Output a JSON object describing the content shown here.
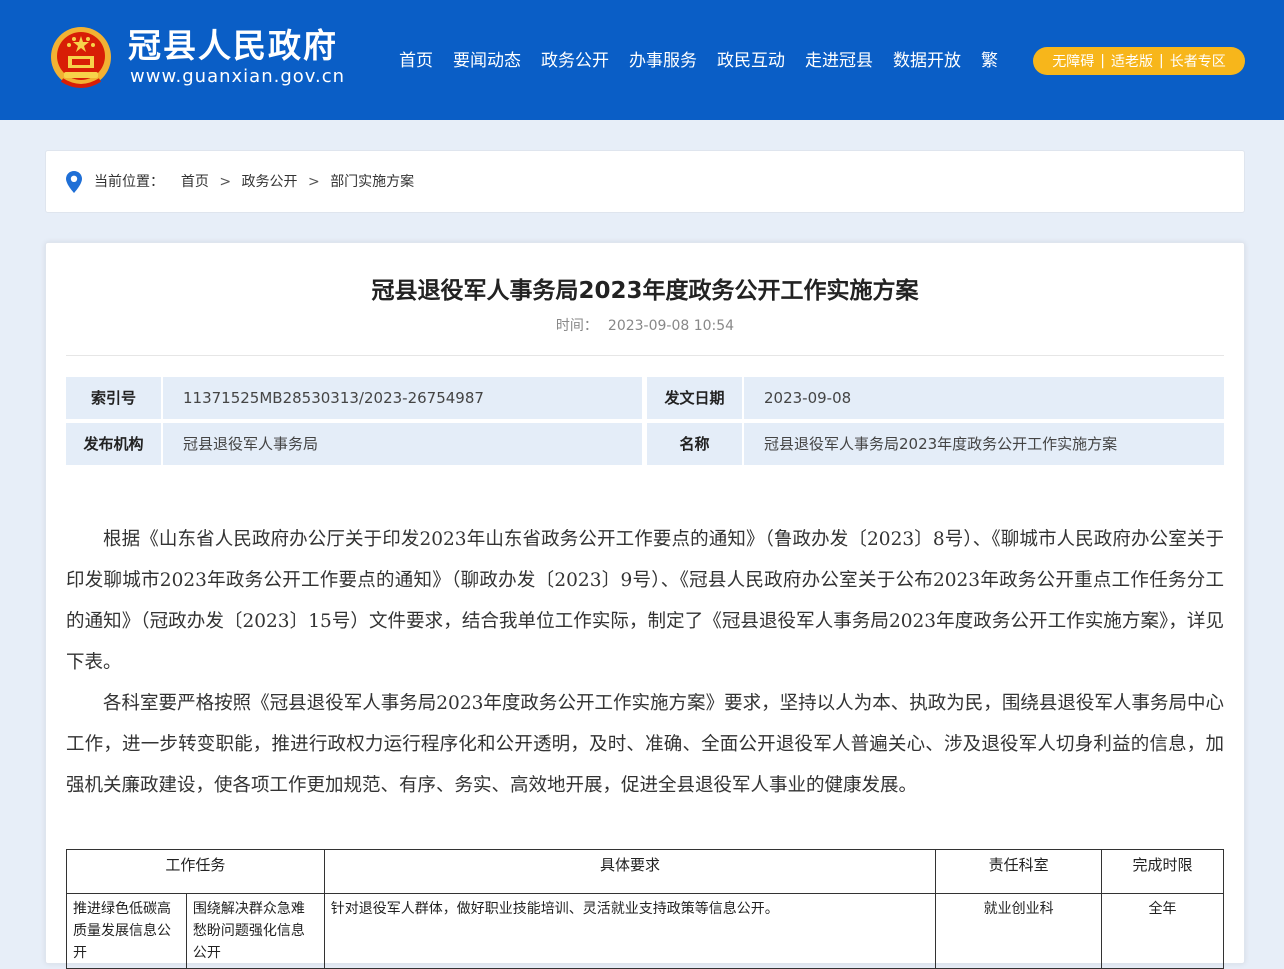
{
  "header": {
    "site_title": "冠县人民政府",
    "site_url": "www.guanxian.gov.cn",
    "nav": [
      "首页",
      "要闻动态",
      "政务公开",
      "办事服务",
      "政民互动",
      "走进冠县",
      "数据开放",
      "繁"
    ],
    "access": [
      "无障碍",
      "适老版",
      "长者专区"
    ],
    "access_sep": "|"
  },
  "breadcrumb": {
    "label": "当前位置：",
    "items": [
      "首页",
      "政务公开",
      "部门实施方案"
    ],
    "sep": ">"
  },
  "article": {
    "title": "冠县退役军人事务局2023年度政务公开工作实施方案",
    "time_label": "时间：",
    "time_value": "2023-09-08 10:54",
    "meta": {
      "index_key": "索引号",
      "index_value": "11371525MB28530313/2023-26754987",
      "date_key": "发文日期",
      "date_value": "2023-09-08",
      "org_key": "发布机构",
      "org_value": "冠县退役军人事务局",
      "name_key": "名称",
      "name_value": "冠县退役军人事务局2023年度政务公开工作实施方案"
    },
    "paragraphs": [
      "根据《山东省人民政府办公厅关于印发2023年山东省政务公开工作要点的通知》（鲁政办发〔2023〕8号）、《聊城市人民政府办公室关于印发聊城市2023年政务公开工作要点的通知》（聊政办发〔2023〕9号）、《冠县人民政府办公室关于公布2023年政务公开重点工作任务分工的通知》（冠政办发〔2023〕15号）文件要求，结合我单位工作实际，制定了《冠县退役军人事务局2023年度政务公开工作实施方案》，详见下表。",
      "各科室要严格按照《冠县退役军人事务局2023年度政务公开工作实施方案》要求，坚持以人为本、执政为民，围绕县退役军人事务局中心工作，进一步转变职能，推进行政权力运行程序化和公开透明，及时、准确、全面公开退役军人普遍关心、涉及退役军人切身利益的信息，加强机关廉政建设，使各项工作更加规范、有序、务实、高效地开展，促进全县退役军人事业的健康发展。"
    ],
    "table": {
      "headers": [
        "工作任务",
        "具体要求",
        "责任科室",
        "完成时限"
      ],
      "rows": [
        {
          "task_a": "推进绿色低碳高质量发展信息公开",
          "task_b": "围绕解决群众急难愁盼问题强化信息公开",
          "requirement": "针对退役军人群体，做好职业技能培训、灵活就业支持政策等信息公开。",
          "dept": "就业创业科",
          "deadline": "全年"
        }
      ]
    }
  },
  "colors": {
    "header_bg": "#0a5ec6",
    "page_bg": "#e7eef8",
    "meta_bg": "#e4edf8",
    "access_bg": "#f7b61b",
    "pin": "#1f6fd6"
  }
}
